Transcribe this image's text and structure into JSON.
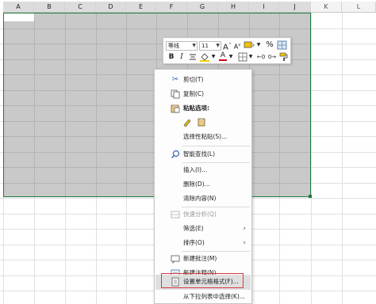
{
  "columns": [
    "A",
    "B",
    "C",
    "D",
    "E",
    "F",
    "G",
    "H",
    "I",
    "J",
    "K",
    "L"
  ],
  "selected_columns": [
    "A",
    "B",
    "C",
    "D",
    "E",
    "F",
    "G",
    "H",
    "I",
    "J"
  ],
  "mini_toolbar": {
    "font_name": "等线",
    "font_size": "11",
    "grow_font": "A",
    "shrink_font": "A",
    "percent": "%",
    "bold": "B",
    "italic": "I",
    "font_color_letter": "A"
  },
  "context_menu": {
    "items": [
      {
        "label": "剪切(T)",
        "icon": "scissors-icon"
      },
      {
        "label": "复制(C)",
        "icon": "copy-icon"
      },
      {
        "label": "粘贴选项:",
        "icon": "clipboard-icon"
      },
      {
        "label": "选择性粘贴(S)...",
        "icon": ""
      },
      {
        "label": "智能查找(L)",
        "icon": "search-icon"
      },
      {
        "label": "插入(I)...",
        "icon": ""
      },
      {
        "label": "删除(D)...",
        "icon": ""
      },
      {
        "label": "清除内容(N)",
        "icon": ""
      },
      {
        "label": "快速分析(Q)",
        "icon": "quick-analysis-icon",
        "disabled": true
      },
      {
        "label": "筛选(E)",
        "icon": "",
        "submenu": true
      },
      {
        "label": "排序(O)",
        "icon": "",
        "submenu": true
      },
      {
        "label": "新建批注(M)",
        "icon": "new-comment-icon"
      },
      {
        "label": "新建注释(N)",
        "icon": "new-note-icon"
      },
      {
        "label": "设置单元格格式(F)...",
        "icon": "format-cells-icon",
        "highlighted": true
      },
      {
        "label": "从下拉列表中选择(K)...",
        "icon": ""
      }
    ]
  },
  "colors": {
    "selection_fill": "#c9c9c9",
    "selection_border": "#1f7a3e",
    "highlight_border": "#d93a3a",
    "font_color_bar": "#d0021b",
    "fill_color_bar": "#f5d000"
  }
}
